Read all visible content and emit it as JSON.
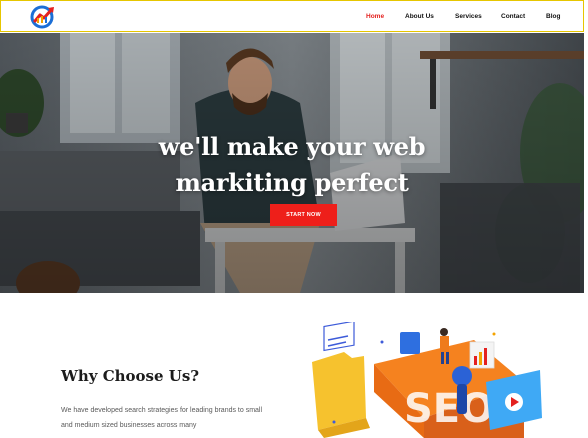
{
  "header": {
    "logo_icon": "analytics-logo-icon",
    "nav": [
      {
        "label": "Home",
        "active": true
      },
      {
        "label": "About Us",
        "active": false
      },
      {
        "label": "Services",
        "active": false
      },
      {
        "label": "Contact",
        "active": false
      },
      {
        "label": "Blog",
        "active": false
      }
    ],
    "border_color": "#e6c600",
    "active_color": "#e4211f"
  },
  "hero": {
    "headline_line1": "we'll make your web",
    "headline_line2": "markiting perfect",
    "cta_label": "START NOW",
    "cta_color": "#ee1f1a"
  },
  "why": {
    "title": "Why Choose Us?",
    "text": "We have developed search strategies for leading brands to small and medium sized businesses across many",
    "illustration_icon": "seo-illustration-icon"
  }
}
